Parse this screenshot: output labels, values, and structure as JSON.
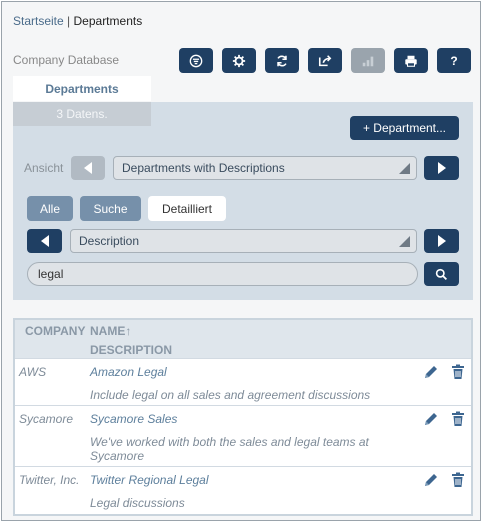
{
  "breadcrumb": {
    "home": "Startseite",
    "separator": " | ",
    "current": "Departments"
  },
  "app": {
    "database_name": "Company Database"
  },
  "toolbar": {
    "buttons": [
      {
        "icon": "filter-icon"
      },
      {
        "icon": "gear-icon"
      },
      {
        "icon": "refresh-icon"
      },
      {
        "icon": "export-icon"
      },
      {
        "icon": "chart-icon",
        "disabled": true
      },
      {
        "icon": "print-icon"
      },
      {
        "icon": "help-icon",
        "label": "?"
      }
    ]
  },
  "tabs": {
    "active": "Departments",
    "record_count": "3 Datens."
  },
  "actions": {
    "add_label": "+ Department..."
  },
  "view": {
    "label": "Ansicht",
    "selected": "Departments with Descriptions"
  },
  "filter_modes": {
    "all": "Alle",
    "search": "Suche",
    "detailed": "Detailliert"
  },
  "field_select": {
    "selected": "Description"
  },
  "search": {
    "value": "legal"
  },
  "table": {
    "columns": {
      "company": "COMPANY",
      "name": "NAME",
      "sort_indicator": "↑",
      "description": "DESCRIPTION"
    },
    "rows": [
      {
        "company": "AWS",
        "name": "Amazon Legal",
        "description": "Include legal on all sales and agreement discussions"
      },
      {
        "company": "Sycamore",
        "name": "Sycamore Sales",
        "description": "We've worked with both the sales and legal teams at Sycamore"
      },
      {
        "company": "Twitter, Inc.",
        "name": "Twitter Regional Legal",
        "description": "Legal discussions"
      }
    ]
  },
  "colors": {
    "primary": "#1f3f63",
    "panel": "#d3dde6",
    "disabled": "#9aa4ad",
    "link": "#5d7f9c"
  }
}
